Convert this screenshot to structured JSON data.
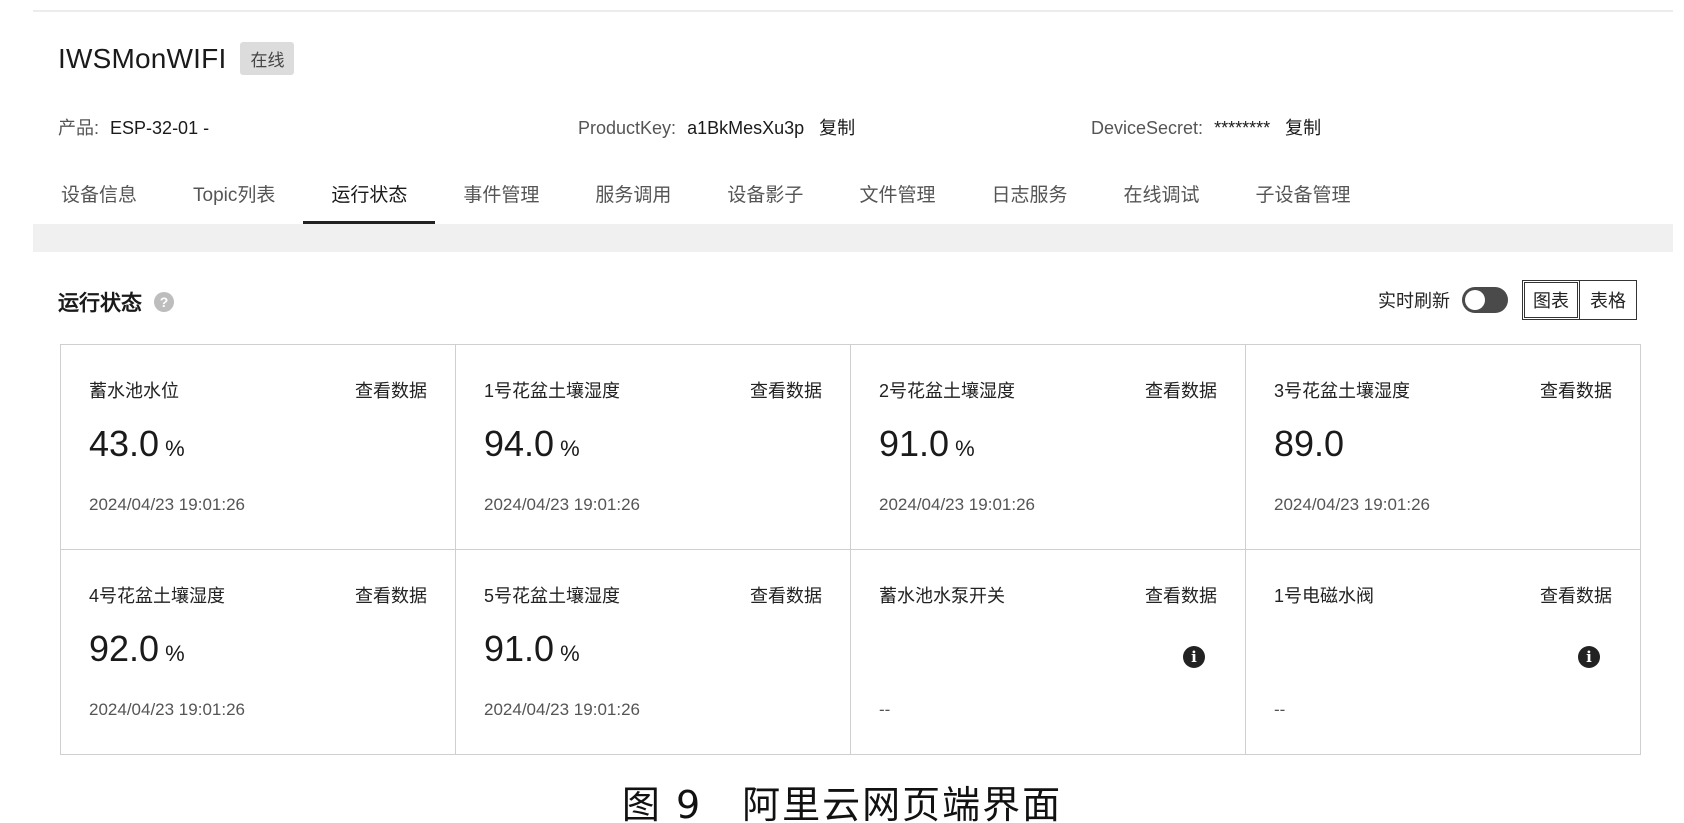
{
  "device": {
    "name": "IWSMonWIFI",
    "status": "在线"
  },
  "meta": {
    "product_label": "产品:",
    "product_value": "ESP-32-01  -",
    "productkey_label": "ProductKey:",
    "productkey_value": "a1BkMesXu3p",
    "productkey_copy": "复制",
    "secret_label": "DeviceSecret:",
    "secret_value": "********",
    "secret_copy": "复制"
  },
  "tabs": [
    {
      "label": "设备信息"
    },
    {
      "label": "Topic列表"
    },
    {
      "label": "运行状态"
    },
    {
      "label": "事件管理"
    },
    {
      "label": "服务调用"
    },
    {
      "label": "设备影子"
    },
    {
      "label": "文件管理"
    },
    {
      "label": "日志服务"
    },
    {
      "label": "在线调试"
    },
    {
      "label": "子设备管理"
    }
  ],
  "active_tab": "运行状态",
  "section": {
    "title": "运行状态",
    "help_icon": "question-circle-icon",
    "realtime_label": "实时刷新",
    "realtime_on": false,
    "view_chart": "图表",
    "view_table": "表格",
    "active_view": "图表"
  },
  "cards": [
    {
      "title": "蓄水池水位",
      "link": "查看数据",
      "value": "43.0",
      "unit": "%",
      "time": "2024/04/23 19:01:26"
    },
    {
      "title": "1号花盆土壤湿度",
      "link": "查看数据",
      "value": "94.0",
      "unit": "%",
      "time": "2024/04/23 19:01:26"
    },
    {
      "title": "2号花盆土壤湿度",
      "link": "查看数据",
      "value": "91.0",
      "unit": "%",
      "time": "2024/04/23 19:01:26"
    },
    {
      "title": "3号花盆土壤湿度",
      "link": "查看数据",
      "value": "89.0",
      "unit": "",
      "time": "2024/04/23 19:01:26"
    },
    {
      "title": "4号花盆土壤湿度",
      "link": "查看数据",
      "value": "92.0",
      "unit": "%",
      "time": "2024/04/23 19:01:26"
    },
    {
      "title": "5号花盆土壤湿度",
      "link": "查看数据",
      "value": "91.0",
      "unit": "%",
      "time": "2024/04/23 19:01:26"
    },
    {
      "title": "蓄水池水泵开关",
      "link": "查看数据",
      "value": "",
      "unit": "",
      "time": "--",
      "info_icon": "info-circle-icon"
    },
    {
      "title": "1号电磁水阀",
      "link": "查看数据",
      "value": "",
      "unit": "",
      "time": "--",
      "info_icon": "info-circle-icon"
    }
  ],
  "caption": "图 9　阿里云网页端界面"
}
